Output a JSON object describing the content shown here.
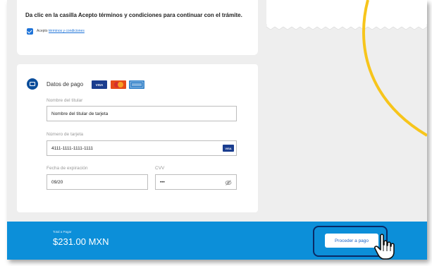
{
  "terms": {
    "heading": "Da clic en la casilla Acepto términos y condiciones para continuar con el trámite.",
    "checkbox_prefix": "Acepto ",
    "checkbox_link": "términos y condiciones",
    "checked": true
  },
  "payment": {
    "title": "Datos de pago",
    "brands": [
      "VISA",
      "MasterCard",
      "AMERICAN EXPRESS"
    ],
    "holder_label": "Nombre del titular",
    "holder_value": "Nombre del titular de tarjeta",
    "card_label": "Número de tarjeta",
    "card_value": "4111-1111-1111-1111",
    "card_badge": "VISA",
    "expiry_label": "Fecha de expiración",
    "expiry_value": "09/20",
    "cvv_label": "CVV",
    "cvv_value": "•••"
  },
  "footer": {
    "total_label": "Total a Pagar",
    "total_value": "$231.00 MXN",
    "proceed_label": "Proceder a pago"
  },
  "colors": {
    "footer_bg": "#0c8fd9",
    "accent": "#1e73d8",
    "highlight_outline": "#0a2a66",
    "decor_arc": "#f7c51b"
  },
  "icons": [
    "check-icon",
    "card-icon",
    "visa-logo-icon",
    "mastercard-logo-icon",
    "amex-logo-icon",
    "eye-off-icon",
    "hand-cursor-icon"
  ]
}
